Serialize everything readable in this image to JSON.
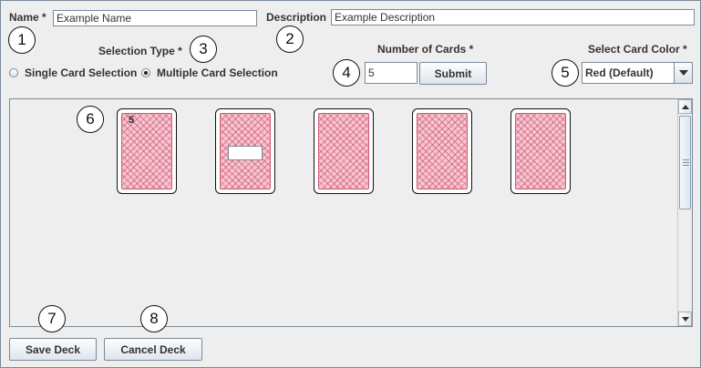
{
  "form": {
    "name_label": "Name *",
    "name_value": "Example Name",
    "description_label": "Description",
    "description_value": "Example Description",
    "selection_type_label": "Selection Type *",
    "single_label": "Single Card Selection",
    "multiple_label": "Multiple Card Selection",
    "selected_mode": "multiple",
    "num_cards_label": "Number of Cards *",
    "num_cards_value": "5",
    "submit_label": "Submit",
    "card_color_label": "Select Card Color *",
    "card_color_value": "Red (Default)"
  },
  "callouts": [
    "1",
    "2",
    "3",
    "4",
    "5",
    "6",
    "7",
    "8"
  ],
  "cards": [
    {
      "value": "5",
      "has_input": false
    },
    {
      "value": "",
      "has_input": true
    },
    {
      "value": "",
      "has_input": false
    },
    {
      "value": "",
      "has_input": false
    },
    {
      "value": "",
      "has_input": false
    }
  ],
  "footer": {
    "save_label": "Save Deck",
    "cancel_label": "Cancel Deck"
  },
  "colors": {
    "card_pattern": "#f4c6d1",
    "card_border": "#d25b74",
    "background": "#eeeeee"
  }
}
